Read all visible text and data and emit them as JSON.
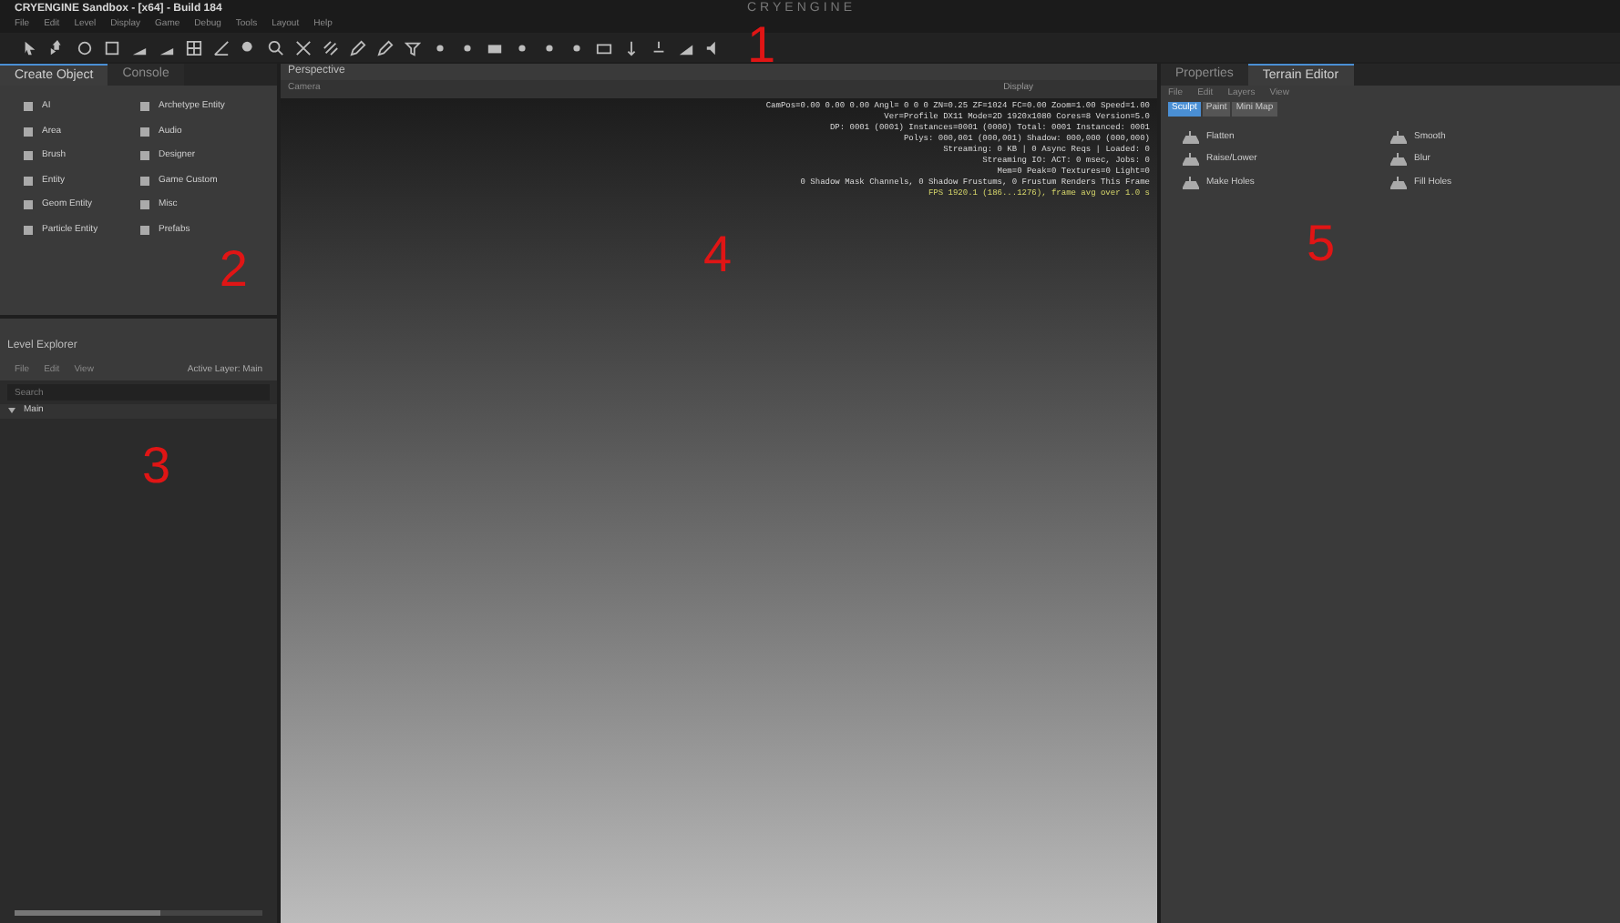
{
  "window": {
    "title": "CRYENGINE Sandbox - [x64] - Build 184",
    "logo": "CRYENGINE"
  },
  "menu": [
    "File",
    "Edit",
    "Level",
    "Display",
    "Game",
    "Debug",
    "Tools",
    "Layout",
    "Help"
  ],
  "create_object": {
    "tabs": [
      {
        "label": "Create Object",
        "selected": true
      },
      {
        "label": "Console",
        "selected": false
      }
    ],
    "items": [
      {
        "label": "AI"
      },
      {
        "label": "Archetype Entity"
      },
      {
        "label": "Area"
      },
      {
        "label": "Audio"
      },
      {
        "label": "Brush"
      },
      {
        "label": "Designer"
      },
      {
        "label": "Entity"
      },
      {
        "label": "Game Custom"
      },
      {
        "label": "Geom Entity"
      },
      {
        "label": "Misc"
      },
      {
        "label": "Particle Entity"
      },
      {
        "label": "Prefabs"
      }
    ]
  },
  "level_explorer": {
    "title": "Level Explorer",
    "menu": [
      "File",
      "Edit",
      "View"
    ],
    "active_layer": "Active Layer: Main",
    "search": {
      "placeholder": "Search"
    },
    "layers": [
      {
        "label": "Main",
        "expanded": true
      }
    ]
  },
  "viewport": {
    "title": "Perspective",
    "camera": "Camera",
    "display": "Display",
    "stats": [
      {
        "text": "CamPos=0.00 0.00 0.00 Angl= 0 0 0 ZN=0.25 ZF=1024 FC=0.00 Zoom=1.00 Speed=1.00",
        "kind": "plain"
      },
      {
        "text": "Ver=Profile DX11 Mode=2D 1920x1080 Cores=8 Version=5.0",
        "kind": "plain"
      },
      {
        "text": "DP: 0001 (0001) Instances=0001 (0000) Total: 0001 Instanced: 0001",
        "kind": "plain"
      },
      {
        "text": "Polys: 000,001 (000,001) Shadow: 000,000 (000,000)",
        "kind": "plain"
      },
      {
        "text": "Streaming: 0 KB | 0 Async Reqs | Loaded: 0",
        "kind": "plain"
      },
      {
        "text": "Streaming IO: ACT: 0 msec, Jobs: 0",
        "kind": "plain"
      },
      {
        "text": "Mem=0 Peak=0 Textures=0 Light=0",
        "kind": "plain"
      },
      {
        "text": "0 Shadow Mask Channels, 0 Shadow Frustums, 0 Frustum Renders This Frame",
        "kind": "plain"
      },
      {
        "text": "FPS 1920.1 (186...1276), frame avg over 1.0 s",
        "kind": "fps"
      }
    ]
  },
  "properties": {
    "tabs": [
      {
        "label": "Properties",
        "selected": false
      },
      {
        "label": "Terrain Editor",
        "selected": true
      }
    ],
    "menu": [
      "File",
      "Edit",
      "Layers",
      "View"
    ],
    "modes": [
      {
        "label": "Sculpt",
        "selected": true
      },
      {
        "label": "Paint",
        "selected": false
      },
      {
        "label": "Mini Map",
        "selected": false
      }
    ],
    "tools": [
      {
        "label": "Flatten"
      },
      {
        "label": "Smooth"
      },
      {
        "label": "Raise/Lower"
      },
      {
        "label": "Blur"
      },
      {
        "label": "Make Holes"
      },
      {
        "label": "Fill Holes"
      }
    ]
  },
  "annotations": [
    "1",
    "2",
    "3",
    "4",
    "5"
  ]
}
